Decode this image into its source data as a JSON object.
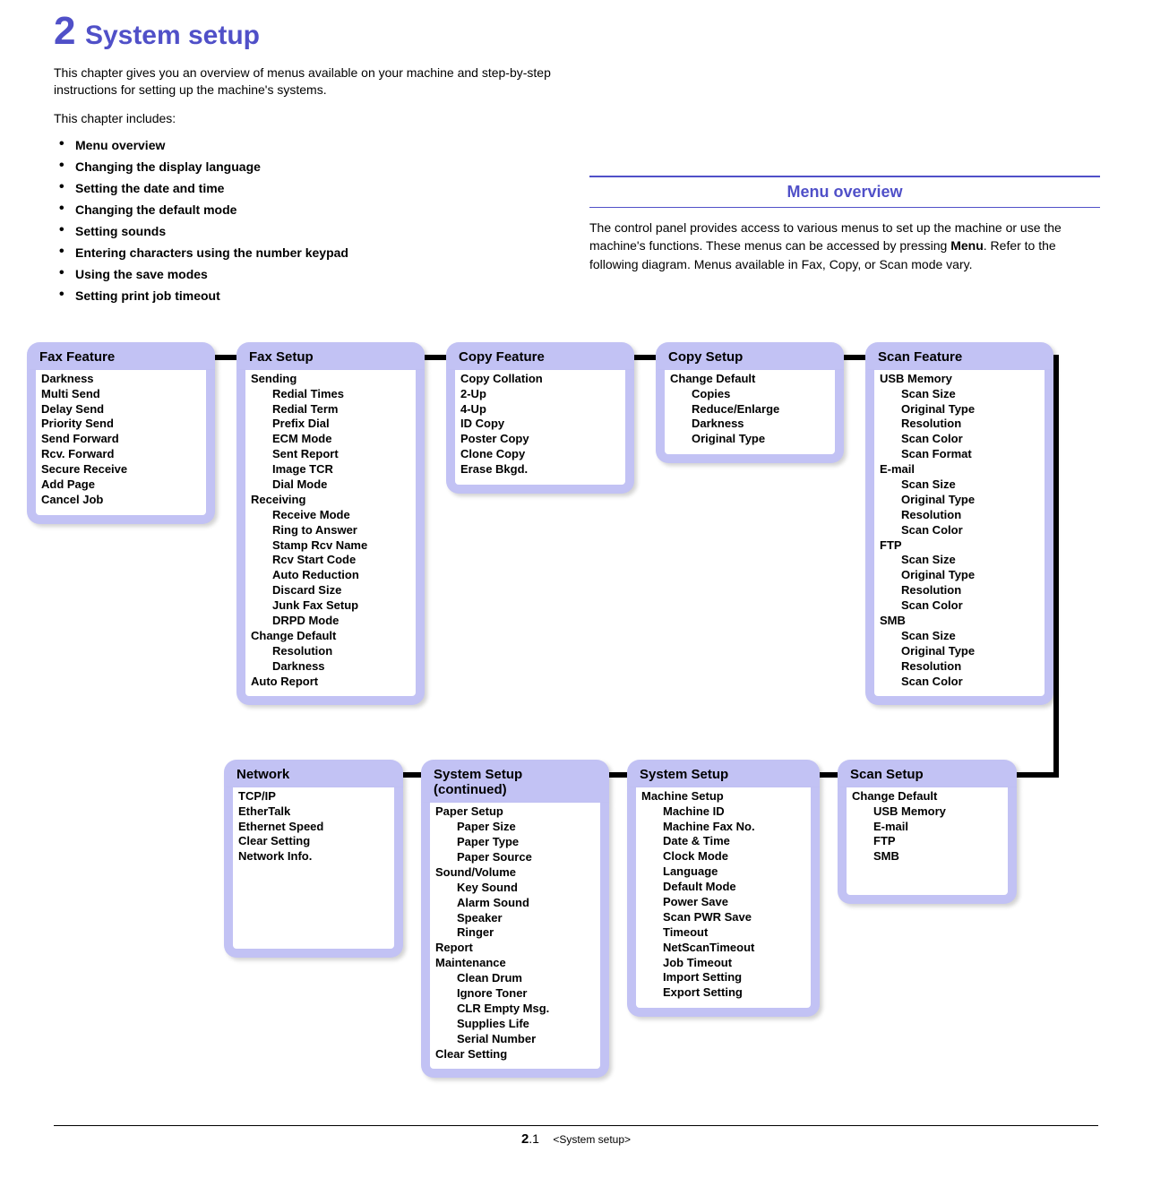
{
  "chapter": {
    "number": "2",
    "title": "System setup"
  },
  "intro": "This chapter gives you an overview of menus available on your machine and step-by-step instructions for setting up the machine's systems.",
  "includes_label": "This chapter includes:",
  "toc": [
    "Menu overview",
    "Changing the display language",
    "Setting the date and time",
    "Changing the default mode",
    "Setting sounds",
    "Entering characters using the number keypad",
    "Using the save modes",
    "Setting print job timeout"
  ],
  "overview": {
    "heading": "Menu overview",
    "body_before": "The control panel provides access to various menus to set up the machine or use the machine's functions. These menus can be accessed by pressing ",
    "body_bold": "Menu",
    "body_after": ". Refer to the following diagram. Menus available in Fax, Copy, or Scan mode vary."
  },
  "boxes": {
    "fax_feature": {
      "title": "Fax Feature",
      "items": [
        "Darkness",
        "Multi Send",
        "Delay Send",
        "Priority Send",
        "Send Forward",
        "Rcv. Forward",
        "Secure Receive",
        "Add Page",
        "Cancel Job"
      ]
    },
    "fax_setup": {
      "title": "Fax Setup",
      "tree": [
        {
          "t": "Sending",
          "c": [
            "Redial Times",
            "Redial Term",
            "Prefix Dial",
            "ECM Mode",
            "Sent Report",
            "Image TCR",
            "Dial Mode"
          ]
        },
        {
          "t": "Receiving",
          "c": [
            "Receive Mode",
            "Ring to Answer",
            "Stamp Rcv Name",
            "Rcv Start Code",
            "Auto Reduction",
            "Discard Size",
            "Junk Fax Setup",
            "DRPD Mode"
          ]
        },
        {
          "t": "Change Default",
          "c": [
            "Resolution",
            "Darkness"
          ]
        },
        {
          "t": "Auto Report",
          "c": []
        }
      ]
    },
    "copy_feature": {
      "title": "Copy Feature",
      "items": [
        "Copy Collation",
        "2-Up",
        "4-Up",
        "ID Copy",
        "Poster Copy",
        "Clone Copy",
        "Erase Bkgd."
      ]
    },
    "copy_setup": {
      "title": "Copy Setup",
      "tree": [
        {
          "t": "Change Default",
          "c": [
            "Copies",
            "Reduce/Enlarge",
            "Darkness",
            "Original Type"
          ]
        }
      ]
    },
    "scan_feature": {
      "title": "Scan Feature",
      "tree": [
        {
          "t": "USB Memory",
          "c": [
            "Scan Size",
            "Original Type",
            "Resolution",
            "Scan Color",
            "Scan Format"
          ]
        },
        {
          "t": "E-mail",
          "c": [
            "Scan Size",
            "Original Type",
            "Resolution",
            "Scan Color"
          ]
        },
        {
          "t": "FTP",
          "c": [
            "Scan Size",
            "Original Type",
            "Resolution",
            "Scan Color"
          ]
        },
        {
          "t": "SMB",
          "c": [
            "Scan Size",
            "Original Type",
            "Resolution",
            "Scan Color"
          ]
        }
      ]
    },
    "network": {
      "title": "Network",
      "items": [
        "TCP/IP",
        "EtherTalk",
        "Ethernet Speed",
        "Clear Setting",
        "Network Info."
      ]
    },
    "system_setup_cont": {
      "title_line1": "System Setup",
      "title_line2": "(continued)",
      "tree": [
        {
          "t": "Paper Setup",
          "c": [
            "Paper Size",
            "Paper Type",
            "Paper Source"
          ]
        },
        {
          "t": "Sound/Volume",
          "c": [
            "Key Sound",
            "Alarm Sound",
            "Speaker",
            "Ringer"
          ]
        },
        {
          "t": "Report",
          "c": []
        },
        {
          "t": "Maintenance",
          "c": [
            "Clean Drum",
            "Ignore Toner",
            "CLR Empty Msg.",
            "Supplies Life",
            "Serial Number"
          ]
        },
        {
          "t": "Clear Setting",
          "c": []
        }
      ]
    },
    "system_setup": {
      "title": "System Setup",
      "tree": [
        {
          "t": "Machine Setup",
          "c": [
            "Machine ID",
            "Machine Fax No.",
            "Date & Time",
            "Clock Mode",
            "Language",
            "Default Mode",
            "Power Save",
            "Scan PWR Save",
            "Timeout",
            "NetScanTimeout",
            "Job Timeout",
            "Import Setting",
            "Export Setting"
          ]
        }
      ]
    },
    "scan_setup": {
      "title": "Scan Setup",
      "tree": [
        {
          "t": "Change Default",
          "c": [
            "USB Memory",
            "E-mail",
            "FTP",
            "SMB"
          ]
        }
      ]
    }
  },
  "footer": {
    "page_bold": "2",
    "page_sub": ".1",
    "page_title": "<System setup>"
  }
}
